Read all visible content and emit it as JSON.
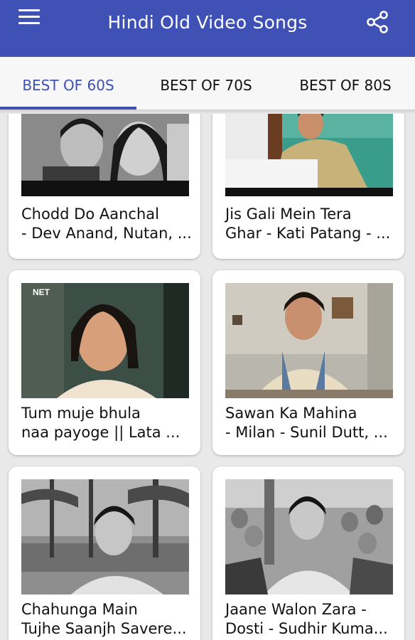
{
  "app": {
    "title": "Hindi Old Video Songs",
    "accent": "#3f51b5"
  },
  "icons": {
    "menu": "hamburger-menu-icon",
    "share": "share-icon"
  },
  "tabs": [
    {
      "label": "BEST OF 60S",
      "active": true
    },
    {
      "label": "BEST OF 70S",
      "active": false
    },
    {
      "label": "BEST OF 80S",
      "active": false
    }
  ],
  "videos": [
    {
      "title": "Chodd Do Aanchal\n- Dev Anand, Nutan, ..."
    },
    {
      "title": "Jis Gali Mein Tera\nGhar - Kati Patang - ..."
    },
    {
      "title": "Tum muje bhula\nnaa payoge || Lata ...",
      "badge": "NET"
    },
    {
      "title": "Sawan Ka Mahina\n- Milan - Sunil Dutt, ..."
    },
    {
      "title": "Chahunga Main\nTujhe Saanjh Savere..."
    },
    {
      "title": "Jaane Walon Zara -\nDosti - Sudhir Kuma..."
    }
  ]
}
